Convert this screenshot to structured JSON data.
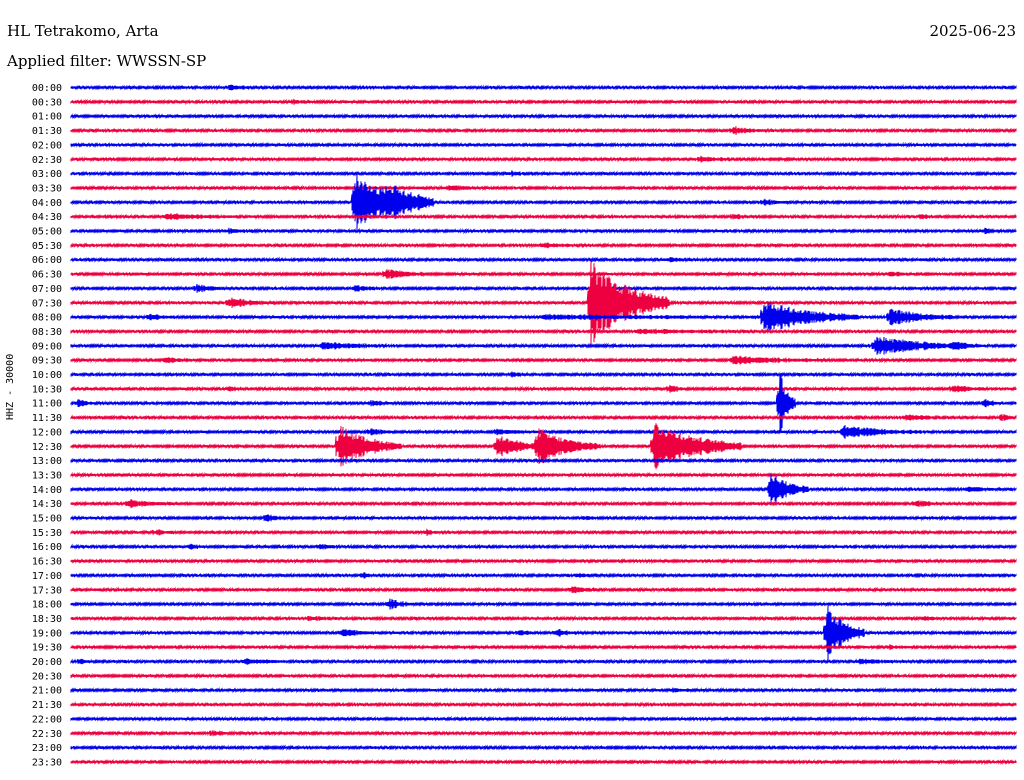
{
  "header": {
    "station": "HL Tetrakomo, Arta",
    "date": "2025-06-23",
    "filter": "Applied filter: WWSSN-SP"
  },
  "colors": {
    "blue": "#0000ee",
    "red": "#ee0040"
  },
  "chart_data": {
    "type": "line",
    "title": "HL Tetrakomo, Arta",
    "ylabel": "HHZ - 30000",
    "grid": false,
    "rows": [
      "00:00",
      "00:30",
      "01:00",
      "01:30",
      "02:00",
      "02:30",
      "03:00",
      "03:30",
      "04:00",
      "04:30",
      "05:00",
      "05:30",
      "06:00",
      "06:30",
      "07:00",
      "07:30",
      "08:00",
      "08:30",
      "09:00",
      "09:30",
      "10:00",
      "10:30",
      "11:00",
      "11:30",
      "12:00",
      "12:30",
      "13:00",
      "13:30",
      "14:00",
      "14:30",
      "15:00",
      "15:30",
      "16:00",
      "16:30",
      "17:00",
      "17:30",
      "18:00",
      "18:30",
      "19:00",
      "19:30",
      "20:00",
      "20:30",
      "21:00",
      "21:30",
      "22:00",
      "22:30",
      "23:00",
      "23:30"
    ],
    "row_colors": [
      "blue",
      "red"
    ],
    "events": [
      {
        "row": 0,
        "minute": 5,
        "amp": 0.3,
        "dur": 1.2
      },
      {
        "row": 1,
        "minute": 7,
        "amp": 0.3,
        "dur": 0.6
      },
      {
        "row": 3,
        "minute": 21,
        "amp": 0.6,
        "dur": 1.0
      },
      {
        "row": 5,
        "minute": 20,
        "amp": 0.4,
        "dur": 1.0
      },
      {
        "row": 6,
        "minute": 14,
        "amp": 0.3,
        "dur": 0.5
      },
      {
        "row": 7,
        "minute": 12,
        "amp": 0.4,
        "dur": 1.0
      },
      {
        "row": 8,
        "minute": 9,
        "amp": 4.8,
        "dur": 2.5
      },
      {
        "row": 8,
        "minute": 10,
        "amp": 1.8,
        "dur": 1.5
      },
      {
        "row": 8,
        "minute": 22,
        "amp": 0.5,
        "dur": 0.8
      },
      {
        "row": 9,
        "minute": 3,
        "amp": 0.5,
        "dur": 2.5
      },
      {
        "row": 9,
        "minute": 21,
        "amp": 0.4,
        "dur": 0.5
      },
      {
        "row": 9,
        "minute": 27,
        "amp": 0.4,
        "dur": 0.4
      },
      {
        "row": 10,
        "minute": 5,
        "amp": 0.3,
        "dur": 0.8
      },
      {
        "row": 10,
        "minute": 29,
        "amp": 0.4,
        "dur": 0.5
      },
      {
        "row": 11,
        "minute": 15,
        "amp": 0.3,
        "dur": 1.5
      },
      {
        "row": 12,
        "minute": 19,
        "amp": 0.4,
        "dur": 0.6
      },
      {
        "row": 13,
        "minute": 10,
        "amp": 0.8,
        "dur": 1.2
      },
      {
        "row": 13,
        "minute": 26,
        "amp": 0.5,
        "dur": 0.6
      },
      {
        "row": 14,
        "minute": 4,
        "amp": 0.6,
        "dur": 1.0
      },
      {
        "row": 14,
        "minute": 9,
        "amp": 0.4,
        "dur": 0.8
      },
      {
        "row": 15,
        "minute": 5,
        "amp": 0.8,
        "dur": 1.5
      },
      {
        "row": 15,
        "minute": 16.5,
        "amp": 7.5,
        "dur": 2.5
      },
      {
        "row": 16,
        "minute": 2.5,
        "amp": 0.4,
        "dur": 0.8
      },
      {
        "row": 16,
        "minute": 22,
        "amp": 2.6,
        "dur": 3.0
      },
      {
        "row": 16,
        "minute": 26,
        "amp": 1.4,
        "dur": 2.0
      },
      {
        "row": 16,
        "minute": 15,
        "amp": 0.3,
        "dur": 8.0
      },
      {
        "row": 17,
        "minute": 18,
        "amp": 0.3,
        "dur": 4.0
      },
      {
        "row": 18,
        "minute": 8,
        "amp": 0.6,
        "dur": 2.0
      },
      {
        "row": 18,
        "minute": 25.5,
        "amp": 1.6,
        "dur": 3.0
      },
      {
        "row": 18,
        "minute": 28,
        "amp": 0.4,
        "dur": 1.0
      },
      {
        "row": 19,
        "minute": 3,
        "amp": 0.4,
        "dur": 1.0
      },
      {
        "row": 19,
        "minute": 21,
        "amp": 0.6,
        "dur": 3.0
      },
      {
        "row": 20,
        "minute": 14,
        "amp": 0.4,
        "dur": 0.4
      },
      {
        "row": 21,
        "minute": 5,
        "amp": 0.4,
        "dur": 0.4
      },
      {
        "row": 21,
        "minute": 19,
        "amp": 0.7,
        "dur": 0.5
      },
      {
        "row": 21,
        "minute": 28,
        "amp": 0.6,
        "dur": 1.0
      },
      {
        "row": 22,
        "minute": 0.2,
        "amp": 0.6,
        "dur": 0.5
      },
      {
        "row": 22,
        "minute": 9.5,
        "amp": 0.4,
        "dur": 0.8
      },
      {
        "row": 22,
        "minute": 22.5,
        "amp": 6.0,
        "dur": 0.5
      },
      {
        "row": 22,
        "minute": 29,
        "amp": 0.7,
        "dur": 0.5
      },
      {
        "row": 23,
        "minute": 26.5,
        "amp": 0.6,
        "dur": 1.0
      },
      {
        "row": 23,
        "minute": 29.5,
        "amp": 0.5,
        "dur": 0.5
      },
      {
        "row": 24,
        "minute": 9.5,
        "amp": 0.5,
        "dur": 0.8
      },
      {
        "row": 24,
        "minute": 13.5,
        "amp": 0.5,
        "dur": 1.0
      },
      {
        "row": 24,
        "minute": 24.5,
        "amp": 1.0,
        "dur": 2.5
      },
      {
        "row": 25,
        "minute": 8.5,
        "amp": 3.6,
        "dur": 2.0
      },
      {
        "row": 25,
        "minute": 13.5,
        "amp": 2.0,
        "dur": 1.5
      },
      {
        "row": 25,
        "minute": 14.8,
        "amp": 3.0,
        "dur": 2.0
      },
      {
        "row": 25,
        "minute": 18.5,
        "amp": 4.2,
        "dur": 2.8
      },
      {
        "row": 28,
        "minute": 22.2,
        "amp": 2.8,
        "dur": 1.2
      },
      {
        "row": 28,
        "minute": 28.5,
        "amp": 0.4,
        "dur": 1.0
      },
      {
        "row": 29,
        "minute": 1.8,
        "amp": 0.6,
        "dur": 1.5
      },
      {
        "row": 29,
        "minute": 26.8,
        "amp": 0.6,
        "dur": 0.8
      },
      {
        "row": 30,
        "minute": 6.2,
        "amp": 0.6,
        "dur": 0.6
      },
      {
        "row": 30,
        "minute": 16.3,
        "amp": 0.3,
        "dur": 0.5
      },
      {
        "row": 31,
        "minute": 2.7,
        "amp": 0.5,
        "dur": 0.6
      },
      {
        "row": 31,
        "minute": 11.3,
        "amp": 0.4,
        "dur": 0.4
      },
      {
        "row": 32,
        "minute": 3.8,
        "amp": 0.4,
        "dur": 0.4
      },
      {
        "row": 32,
        "minute": 7.9,
        "amp": 0.4,
        "dur": 0.6
      },
      {
        "row": 34,
        "minute": 9.3,
        "amp": 0.4,
        "dur": 0.4
      },
      {
        "row": 34,
        "minute": 16.1,
        "amp": 0.3,
        "dur": 0.8
      },
      {
        "row": 35,
        "minute": 15.9,
        "amp": 0.5,
        "dur": 0.8
      },
      {
        "row": 36,
        "minute": 10.1,
        "amp": 0.8,
        "dur": 0.8
      },
      {
        "row": 37,
        "minute": 7.5,
        "amp": 0.3,
        "dur": 1.0
      },
      {
        "row": 37,
        "minute": 27.1,
        "amp": 0.3,
        "dur": 0.5
      },
      {
        "row": 38,
        "minute": 8.6,
        "amp": 0.6,
        "dur": 1.0
      },
      {
        "row": 38,
        "minute": 14.2,
        "amp": 0.6,
        "dur": 0.5
      },
      {
        "row": 38,
        "minute": 15.4,
        "amp": 0.7,
        "dur": 0.6
      },
      {
        "row": 38,
        "minute": 24.0,
        "amp": 5.0,
        "dur": 1.2
      },
      {
        "row": 39,
        "minute": 26.0,
        "amp": 0.3,
        "dur": 0.6
      },
      {
        "row": 40,
        "minute": 0.3,
        "amp": 0.4,
        "dur": 0.3
      },
      {
        "row": 40,
        "minute": 5.5,
        "amp": 0.5,
        "dur": 1.2
      },
      {
        "row": 40,
        "minute": 25.0,
        "amp": 0.3,
        "dur": 2.0
      },
      {
        "row": 42,
        "minute": 19.1,
        "amp": 0.3,
        "dur": 0.5
      },
      {
        "row": 45,
        "minute": 4.5,
        "amp": 0.5,
        "dur": 0.5
      }
    ]
  }
}
